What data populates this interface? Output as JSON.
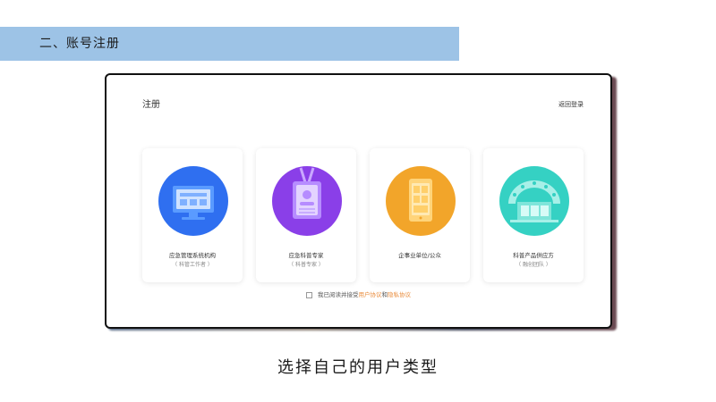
{
  "section": {
    "title": "二、账号注册"
  },
  "register": {
    "title": "注册",
    "back_link": "返回登录",
    "cards": [
      {
        "label": "应急管理系统机构",
        "sub": "（ 科管工作者 ）"
      },
      {
        "label": "应急科普专家",
        "sub": "（ 科普专家 ）"
      },
      {
        "label": "企事业单位/公众",
        "sub": ""
      },
      {
        "label": "科普产品供应方",
        "sub": "（ 融创团队 ）"
      }
    ],
    "agreement": {
      "prefix": "我已阅读并接受",
      "user_link": "用户协议",
      "conj": "和",
      "privacy_link": "隐私协议"
    }
  },
  "caption": "选择自己的用户类型",
  "colors": {
    "section_bar": "#9dc3e6",
    "blue": "#2f6ff0",
    "purple": "#8a3fe8",
    "orange": "#f2a52a",
    "teal": "#35d1c3",
    "link": "#e98b3a"
  }
}
